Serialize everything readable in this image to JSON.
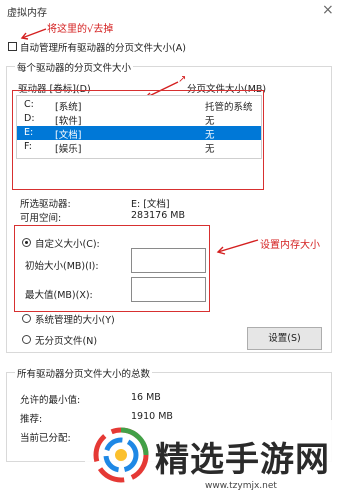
{
  "window": {
    "title": "虚拟内存",
    "close_glyph": "×"
  },
  "auto_manage": {
    "label": "自动管理所有驱动器的分页文件大小(A)",
    "checked": false
  },
  "group_drives": {
    "title": "每个驱动器的分页文件大小",
    "col_drive": "驱动器 [卷标](D)",
    "col_size": "分页文件大小(MB)",
    "rows": [
      {
        "drive": "C:",
        "label": "[系统]",
        "size": "托管的系统",
        "selected": false
      },
      {
        "drive": "D:",
        "label": "[软件]",
        "size": "无",
        "selected": false
      },
      {
        "drive": "E:",
        "label": "[文档]",
        "size": "无",
        "selected": true
      },
      {
        "drive": "F:",
        "label": "[娱乐]",
        "size": "无",
        "selected": false
      }
    ],
    "selected_drive_label": "所选驱动器:",
    "selected_drive_value": "E:  [文档]",
    "free_space_label": "可用空间:",
    "free_space_value": "283176 MB",
    "custom_size_label": "自定义大小(C):",
    "initial_size_label": "初始大小(MB)(I):",
    "initial_size_value": "",
    "max_size_label": "最大值(MB)(X):",
    "max_size_value": "",
    "system_managed_label": "系统管理的大小(Y)",
    "no_paging_label": "无分页文件(N)",
    "set_button": "设置(S)"
  },
  "group_total": {
    "title": "所有驱动器分页文件大小的总数",
    "min_label": "允许的最小值:",
    "min_value": "16 MB",
    "recommended_label": "推荐:",
    "recommended_value": "1910 MB",
    "current_label": "当前已分配:"
  },
  "annotations": {
    "remove_check": "将这里的√去掉",
    "set_memory": "设置内存大小",
    "color": "#d42020"
  },
  "watermark": {
    "brand": "精选手游网",
    "url": "www.tzymjx.net"
  }
}
